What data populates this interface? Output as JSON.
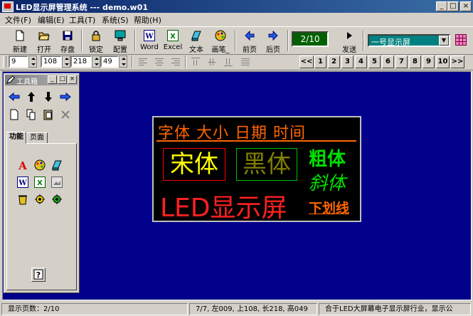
{
  "window": {
    "title": "LED显示屏管理系统 --- demo.w01"
  },
  "menu": [
    "文件(F)",
    "编辑(E)",
    "工具(T)",
    "系统(S)",
    "帮助(H)"
  ],
  "toolbar": {
    "buttons": [
      {
        "label": "新建",
        "icon": "new-file-icon"
      },
      {
        "label": "打开",
        "icon": "open-folder-icon"
      },
      {
        "label": "存盘",
        "icon": "save-disk-icon"
      },
      {
        "label": "锁定",
        "icon": "lock-icon"
      },
      {
        "label": "配置",
        "icon": "monitor-config-icon"
      },
      {
        "label": "Word",
        "icon": "word-icon"
      },
      {
        "label": "Excel",
        "icon": "excel-icon"
      },
      {
        "label": "文本",
        "icon": "text-icon"
      },
      {
        "label": "画笔_",
        "icon": "paint-icon"
      },
      {
        "label": "前页",
        "icon": "arrow-left-icon"
      },
      {
        "label": "后页",
        "icon": "arrow-right-icon"
      },
      {
        "label": "发送",
        "icon": "send-icon"
      }
    ],
    "page_indicator": "2/10",
    "screen_select": "一号显示屏"
  },
  "toolbar2": {
    "fields": [
      "9",
      "108",
      "218",
      "49"
    ],
    "pages": [
      "1",
      "2",
      "3",
      "4",
      "5",
      "6",
      "7",
      "8",
      "9",
      "10"
    ],
    "nav_prev": "<<",
    "nav_next": ">>"
  },
  "tools_window": {
    "title": "工具箱",
    "tabs": [
      "功能",
      "页面"
    ]
  },
  "led": {
    "row1": "字体 大小 日期 时间",
    "song": "宋体",
    "hei": "黑体",
    "cu": "粗体",
    "xie": "斜体",
    "led": "LED显示屏",
    "underline": "下划线"
  },
  "status": {
    "pages": "显示页数：2/10",
    "position": "7/7, 左009, 上108, 长218, 高049",
    "info": "合于LED大屏幕电子显示屏行业，显示公"
  }
}
